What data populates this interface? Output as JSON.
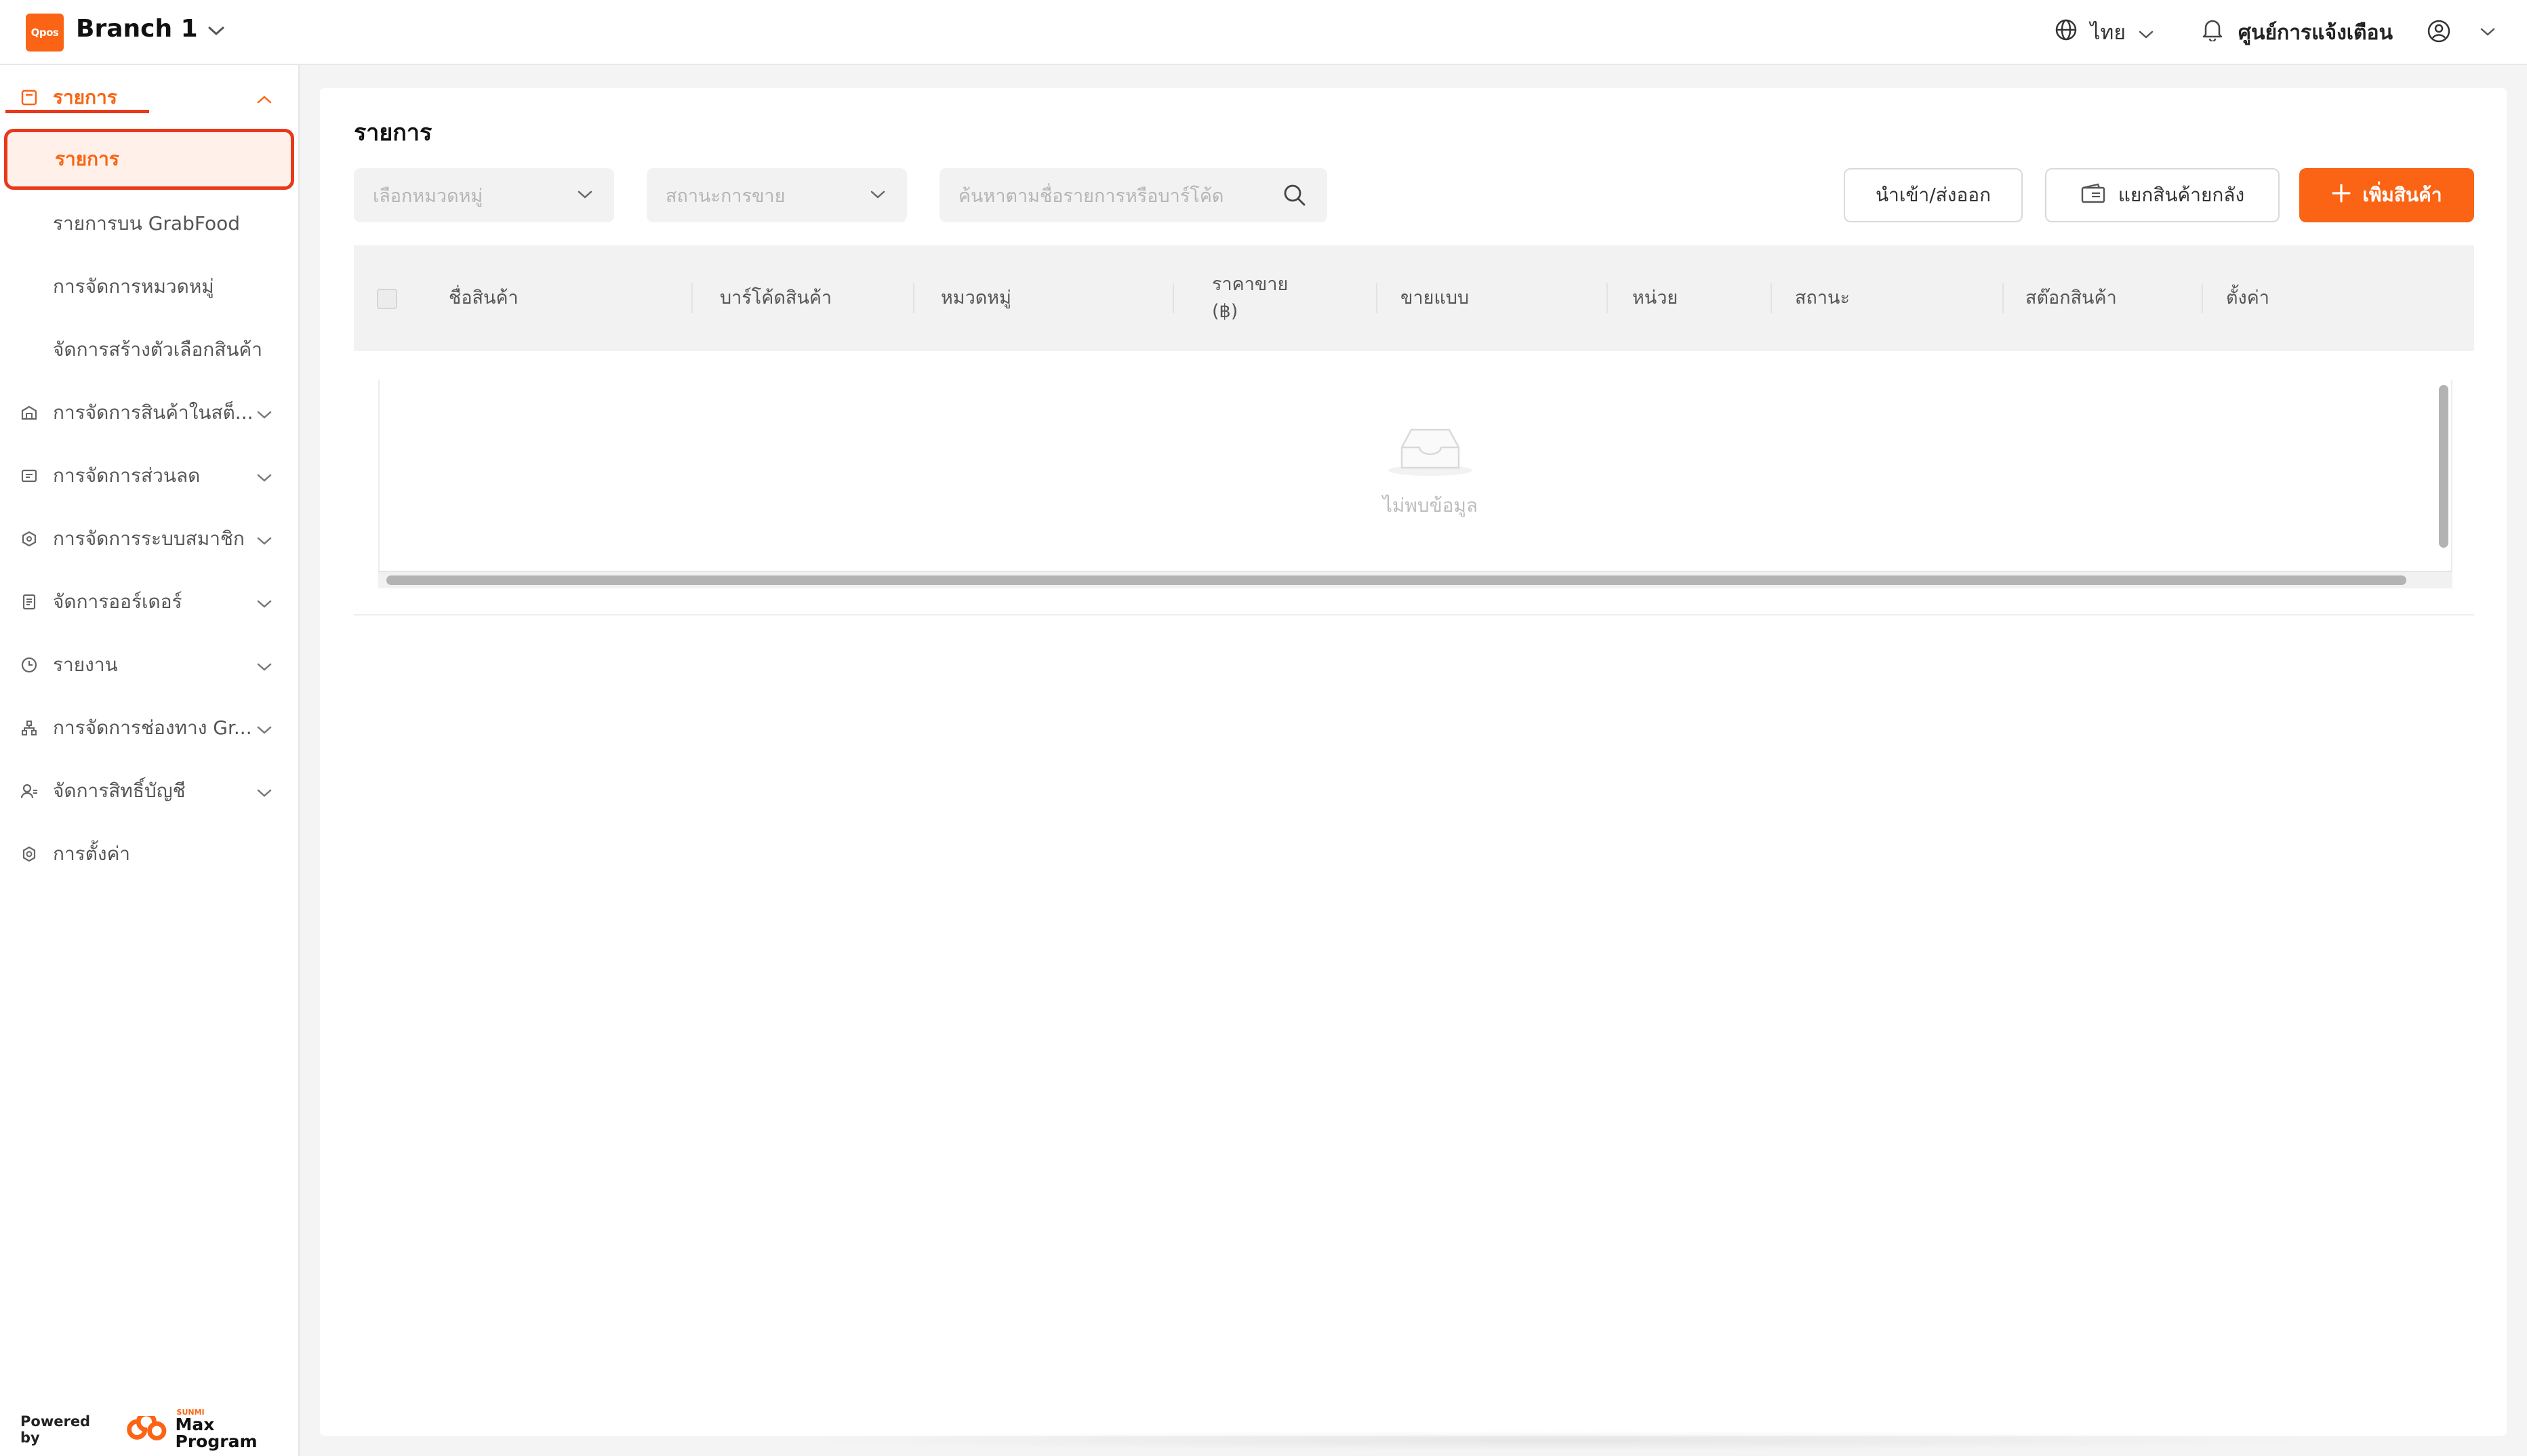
{
  "brand": {
    "logo_text": "Qpos",
    "accent": "#fa6414",
    "highlight_red": "#e8391a"
  },
  "header": {
    "branch_name": "Branch 1",
    "language": "ไทย",
    "notification_center": "ศูนย์การแจ้งเตือน"
  },
  "sidebar": {
    "menu_root": {
      "label": "รายการ",
      "icon": "product-list-icon"
    },
    "submenu": [
      {
        "label": "รายการ"
      },
      {
        "label": "รายการบน GrabFood"
      },
      {
        "label": "การจัดการหมวดหมู่"
      },
      {
        "label": "จัดการสร้างตัวเลือกสินค้า"
      }
    ],
    "items": [
      {
        "label": "การจัดการสินค้าในสต็...",
        "icon": "warehouse-icon"
      },
      {
        "label": "การจัดการส่วนลด",
        "icon": "discount-icon"
      },
      {
        "label": "การจัดการระบบสมาชิก",
        "icon": "member-icon"
      },
      {
        "label": "จัดการออร์เดอร์",
        "icon": "order-icon"
      },
      {
        "label": "รายงาน",
        "icon": "report-icon"
      },
      {
        "label": "การจัดการช่องทาง Gr...",
        "icon": "channel-icon"
      },
      {
        "label": "จัดการสิทธิ์บัญชี",
        "icon": "account-permission-icon"
      },
      {
        "label": "การตั้งค่า",
        "icon": "settings-icon"
      }
    ],
    "powered_by": "Powered by",
    "powered_brand_small": "SUNMI",
    "powered_brand": "Max Program"
  },
  "main": {
    "title": "รายการ",
    "filters": {
      "category_placeholder": "เลือกหมวดหมู่",
      "status_placeholder": "สถานะการขาย",
      "search_placeholder": "ค้นหาตามชื่อรายการหรือบาร์โค้ด"
    },
    "buttons": {
      "import_export": "นำเข้า/ส่งออก",
      "split_stock": "แยกสินค้ายกลัง",
      "add_product": "เพิ่มสินค้า"
    },
    "table": {
      "columns": {
        "name": "ชื่อสินค้า",
        "barcode": "บาร์โค้ดสินค้า",
        "category": "หมวดหมู่",
        "price_line1": "ราคาขาย",
        "price_line2": "(฿)",
        "sell_type": "ขายแบบ",
        "unit": "หน่วย",
        "status": "สถานะ",
        "stock": "สต๊อกสินค้า",
        "settings": "ตั้งค่า"
      },
      "empty_text": "ไม่พบข้อมูล"
    }
  }
}
